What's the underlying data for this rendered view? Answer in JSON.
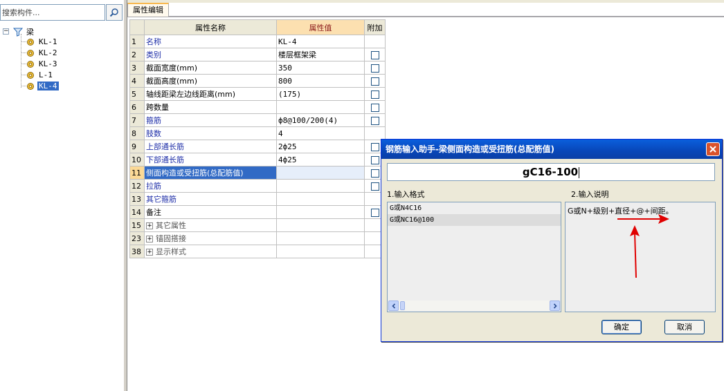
{
  "search": {
    "placeholder": "搜索构件..."
  },
  "tree": {
    "root_label": "梁",
    "items": [
      {
        "label": "KL-1"
      },
      {
        "label": "KL-2"
      },
      {
        "label": "KL-3"
      },
      {
        "label": "L-1"
      },
      {
        "label": "KL-4",
        "selected": true
      }
    ]
  },
  "tab": {
    "label": "属性编辑"
  },
  "grid": {
    "headers": {
      "name": "属性名称",
      "value": "属性值",
      "extra": "附加"
    },
    "rows": [
      {
        "num": "1",
        "name": "名称",
        "value": "KL-4"
      },
      {
        "num": "2",
        "name": "类别",
        "value": "楼层框架梁"
      },
      {
        "num": "3",
        "name": "截面宽度(mm)",
        "value": "350"
      },
      {
        "num": "4",
        "name": "截面高度(mm)",
        "value": "800"
      },
      {
        "num": "5",
        "name": "轴线距梁左边线距离(mm)",
        "value": "(175)"
      },
      {
        "num": "6",
        "name": "跨数量",
        "value": ""
      },
      {
        "num": "7",
        "name": "箍筋",
        "value": "ф8@100/200(4)"
      },
      {
        "num": "8",
        "name": "肢数",
        "value": "4"
      },
      {
        "num": "9",
        "name": "上部通长筋",
        "value": "2ф25"
      },
      {
        "num": "10",
        "name": "下部通长筋",
        "value": "4ф25"
      },
      {
        "num": "11",
        "name": "侧面构造或受扭筋(总配筋值)",
        "value": ""
      },
      {
        "num": "12",
        "name": "拉筋",
        "value": ""
      },
      {
        "num": "13",
        "name": "其它箍筋",
        "value": ""
      },
      {
        "num": "14",
        "name": "备注",
        "value": ""
      },
      {
        "num": "15",
        "name": "其它属性",
        "value": ""
      },
      {
        "num": "23",
        "name": "锚固搭接",
        "value": ""
      },
      {
        "num": "38",
        "name": "显示样式",
        "value": ""
      }
    ]
  },
  "dialog": {
    "title": "钢筋输入助手-梁侧面构造或受扭筋(总配筋值)",
    "input_value": "gC16-100",
    "format_label": "1.输入格式",
    "desc_label": "2.输入说明",
    "formats": [
      "G或N4C16",
      "G或NC16@100"
    ],
    "description": "G或N+级别+直径+@+间距。",
    "ok_label": "确定",
    "cancel_label": "取消"
  },
  "colors": {
    "selection": "#316ac5",
    "annotation_arrow": "#e00000",
    "title_bar": "#0a4fc8"
  }
}
